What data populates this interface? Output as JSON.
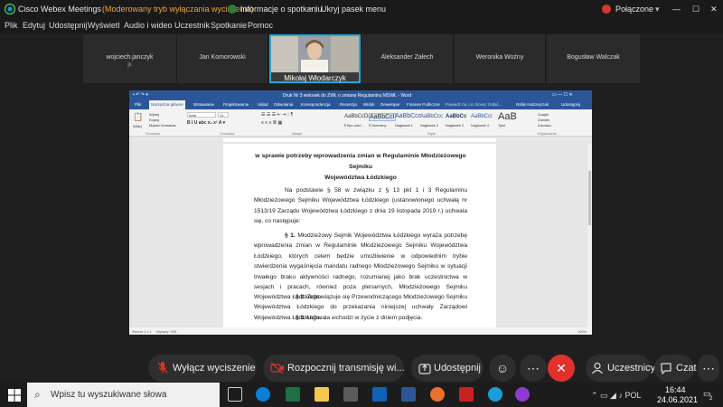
{
  "webex": {
    "app_title": "Cisco Webex Meetings",
    "mode_note": "(Moderowany tryb wyłączania wyciszenia)",
    "meeting_info": "Informacje o spotkaniu",
    "hide_menu": "Ukryj pasek menu",
    "connection": "Połączone",
    "menu": [
      "Plik",
      "Edytuj",
      "Udostępnij",
      "Wyświetl",
      "Audio i wideo",
      "Uczestnik",
      "Spotkanie",
      "Pomoc"
    ]
  },
  "participants": [
    {
      "name": "wojciech.janczyk",
      "sub": "jx"
    },
    {
      "name": "Jan Komorowski"
    },
    {
      "name": "Mikołaj Włodarczyk"
    },
    {
      "name": "Aleksander Załech"
    },
    {
      "name": "Weronika Woźny"
    },
    {
      "name": "Bogusław Walczak"
    }
  ],
  "word": {
    "title": "Druk Nr 3 wniosek do ZWŁ o zmianę Regulaminu MSWŁ - Word",
    "user": "Rafał Andrzejczak",
    "share": "Udostępnij",
    "tabs": [
      "Plik",
      "Narzędzia główne",
      "Wstawianie",
      "Projektowanie",
      "Układ",
      "Odwołania",
      "Korespondencja",
      "Recenzja",
      "Widok",
      "Deweloper",
      "Finanse Publiczne"
    ],
    "tell_me": "Powiedz mi, co chcesz zrobić...",
    "clipboard": [
      "Wytnij",
      "Kopiuj",
      "Malarz formatów"
    ],
    "paste": "Wklej",
    "font_name": "Arial",
    "font_size": "12",
    "styles": [
      "AaBbCcDc",
      "AaBbCcI",
      "AaBbCcc",
      "AaBbCcc",
      "AaBbCc",
      "AaBbCcI",
      "AaB"
    ],
    "style_names": [
      "¶ Bez odst...",
      "¶ Normalny",
      "Nagłówek 1",
      "Nagłówek 2",
      "Nagłówek 3",
      "Nagłówek 4",
      "Tytuł"
    ],
    "editing": [
      "Znajdź",
      "Zamień",
      "Zaznacz"
    ],
    "group_labels": [
      "Schowek",
      "Czcionka",
      "Akapit",
      "Style",
      "Edytowanie"
    ],
    "status": [
      "Strona 1 z 1",
      "Wyrazy: 403"
    ],
    "zoom": "100%"
  },
  "document": {
    "heading_line1": "w sprawie potrzeby wprowadzenia zmian w Regulaminie Młodzieżowego Sejmiku",
    "heading_line2": "Województwa Łódzkiego",
    "intro": "Na podstawie § 58 w związku z § 13 pkt 1 i 3 Regulaminu Młodzieżowego Sejmiku Województwa Łódzkiego (ustanowionego uchwałą nr 1513/19 Zarządu Województwa Łódzkiego z dnia 19 listopada 2019 r.) uchwala się, co następuje:",
    "p1_label": "§ 1.",
    "p1": "Młodzieżowy Sejmik Województwa Łódzkiego wyraża potrzebę wprowadzenia zmian w Regulaminie Młodzieżowego Sejmiku Województwa Łódzkiego, których celem będzie umożliwienie w odpowiednim trybie stwierdzenia wygaśnięcia mandatu radnego Młodzieżowego Sejmiku w sytuacji trwałego braku aktywności radnego, rozumianej jako brak uczestnictwa w sesjach i pracach, również poza plenarnych, Młodzieżowego Sejmiku Województwa Łódzkiego.",
    "p2_label": "§ 2.",
    "p2": "Zobowiązuje się Przewodniczącego Młodzieżowego Sejmiku Województwa Łódzkiego do przekazania niniejszej uchwały Zarządowi Województwa Łódzkiego.",
    "p3_label": "§ 3.",
    "p3": "Uchwała wchodzi w życie z dniem podjęcia."
  },
  "controls": {
    "mute": "Wyłącz wyciszenie",
    "stream": "Rozpocznij transmisję wi...",
    "share": "Udostępnij",
    "participants": "Uczestnicy",
    "chat": "Czat"
  },
  "taskbar": {
    "search_placeholder": "Wpisz tu wyszukiwane słowa",
    "time": "16:44",
    "date": "24.06.2021",
    "notifications": "2"
  },
  "colors": {
    "accent": "#26a7e0",
    "word_blue": "#2b579a",
    "end_red": "#e0322b",
    "mute_red": "#e0322b"
  }
}
